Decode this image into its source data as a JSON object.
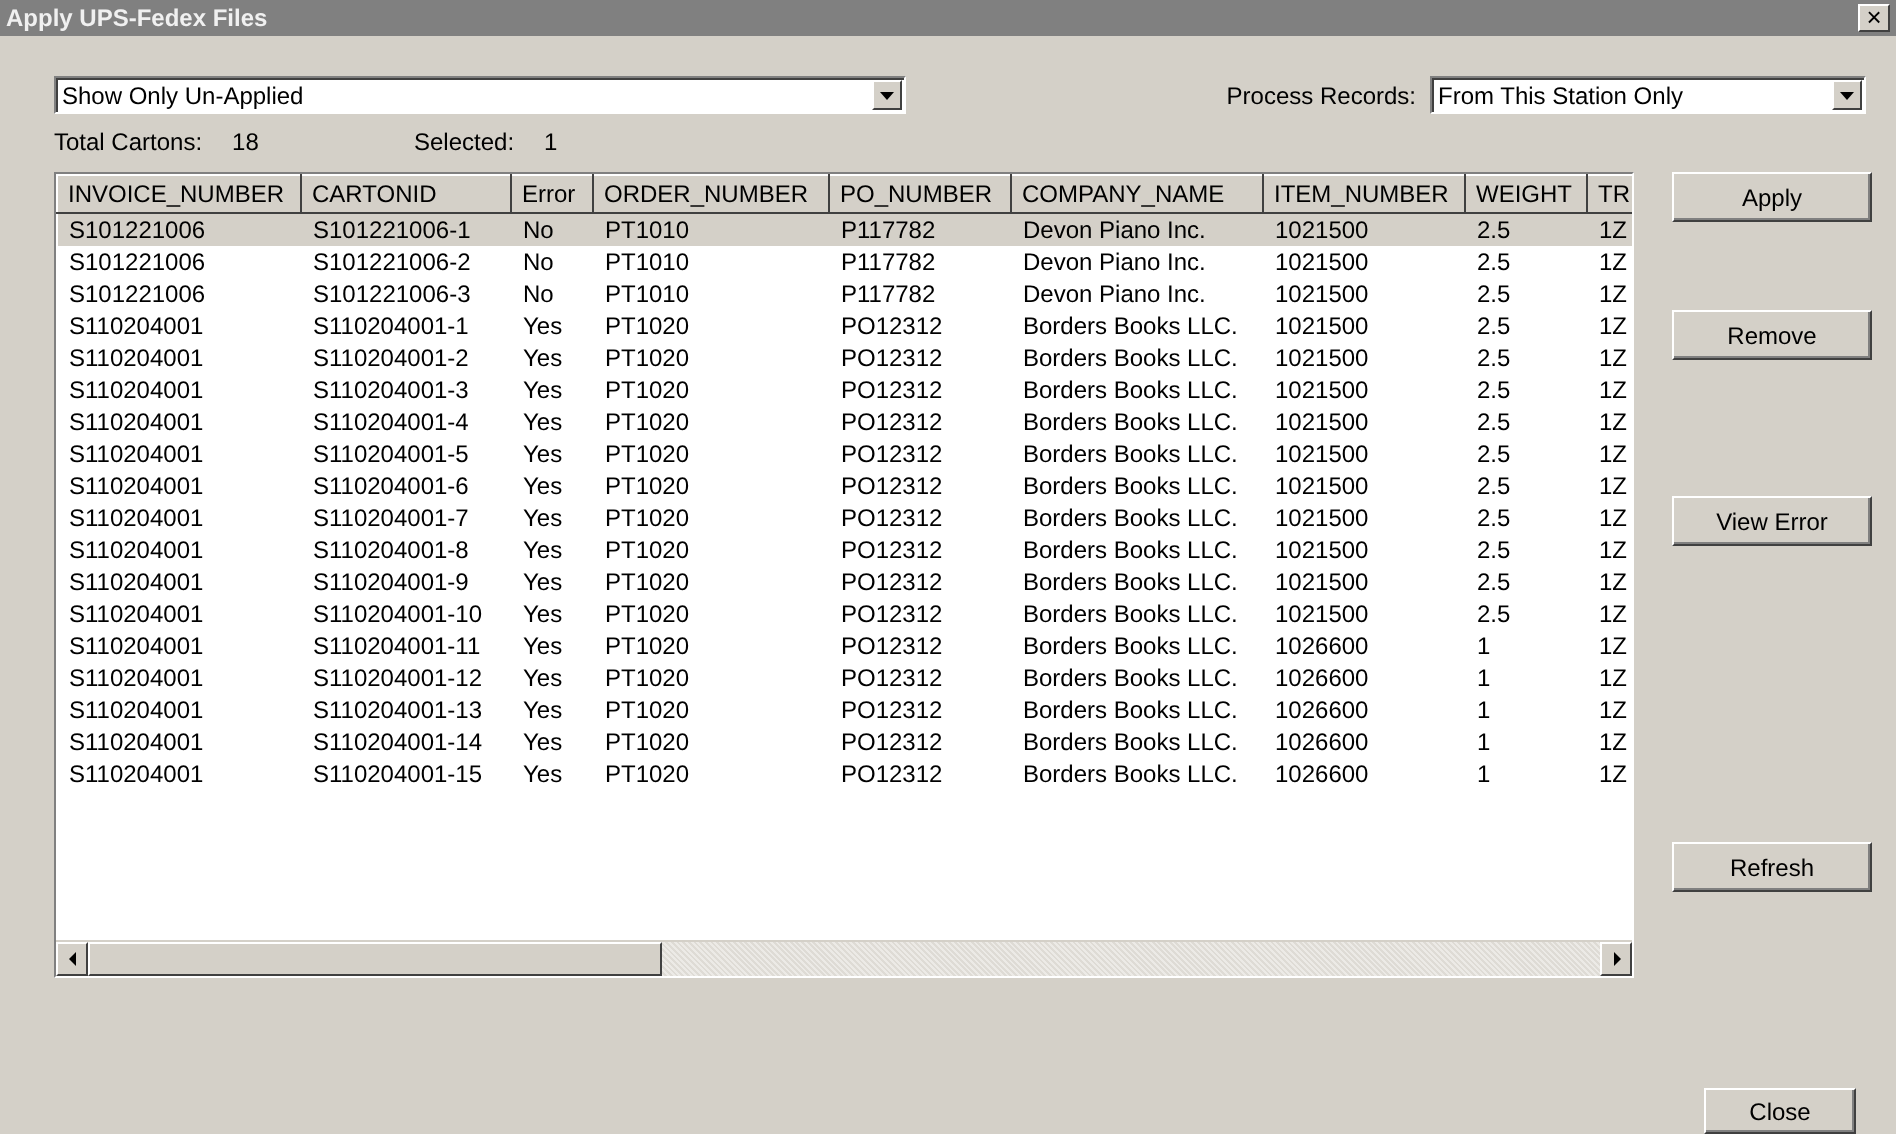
{
  "window": {
    "title": "Apply UPS-Fedex Files",
    "close": "×"
  },
  "filter": {
    "value": "Show Only Un-Applied"
  },
  "process_records": {
    "label": "Process Records:",
    "value": "From This Station Only"
  },
  "totals": [
    {
      "label": "Total Cartons:",
      "value": "18"
    },
    {
      "label": "Selected:",
      "value": "1"
    }
  ],
  "table": {
    "columns": [
      "INVOICE_NUMBER",
      "CARTONID",
      "Error",
      "ORDER_NUMBER",
      "PO_NUMBER",
      "COMPANY_NAME",
      "ITEM_NUMBER",
      "WEIGHT",
      "TR"
    ],
    "rows": [
      {
        "selected": true,
        "cells": [
          "S101221006",
          "S101221006-1",
          "No",
          "PT1010",
          "P117782",
          "Devon Piano Inc.",
          "1021500",
          "2.5",
          "1Z"
        ]
      },
      {
        "selected": false,
        "cells": [
          "S101221006",
          "S101221006-2",
          "No",
          "PT1010",
          "P117782",
          "Devon Piano Inc.",
          "1021500",
          "2.5",
          "1Z"
        ]
      },
      {
        "selected": false,
        "cells": [
          "S101221006",
          "S101221006-3",
          "No",
          "PT1010",
          "P117782",
          "Devon Piano Inc.",
          "1021500",
          "2.5",
          "1Z"
        ]
      },
      {
        "selected": false,
        "cells": [
          "S110204001",
          "S110204001-1",
          "Yes",
          "PT1020",
          "PO12312",
          "Borders Books LLC.",
          "1021500",
          "2.5",
          "1Z"
        ]
      },
      {
        "selected": false,
        "cells": [
          "S110204001",
          "S110204001-2",
          "Yes",
          "PT1020",
          "PO12312",
          "Borders Books LLC.",
          "1021500",
          "2.5",
          "1Z"
        ]
      },
      {
        "selected": false,
        "cells": [
          "S110204001",
          "S110204001-3",
          "Yes",
          "PT1020",
          "PO12312",
          "Borders Books LLC.",
          "1021500",
          "2.5",
          "1Z"
        ]
      },
      {
        "selected": false,
        "cells": [
          "S110204001",
          "S110204001-4",
          "Yes",
          "PT1020",
          "PO12312",
          "Borders Books LLC.",
          "1021500",
          "2.5",
          "1Z"
        ]
      },
      {
        "selected": false,
        "cells": [
          "S110204001",
          "S110204001-5",
          "Yes",
          "PT1020",
          "PO12312",
          "Borders Books LLC.",
          "1021500",
          "2.5",
          "1Z"
        ]
      },
      {
        "selected": false,
        "cells": [
          "S110204001",
          "S110204001-6",
          "Yes",
          "PT1020",
          "PO12312",
          "Borders Books LLC.",
          "1021500",
          "2.5",
          "1Z"
        ]
      },
      {
        "selected": false,
        "cells": [
          "S110204001",
          "S110204001-7",
          "Yes",
          "PT1020",
          "PO12312",
          "Borders Books LLC.",
          "1021500",
          "2.5",
          "1Z"
        ]
      },
      {
        "selected": false,
        "cells": [
          "S110204001",
          "S110204001-8",
          "Yes",
          "PT1020",
          "PO12312",
          "Borders Books LLC.",
          "1021500",
          "2.5",
          "1Z"
        ]
      },
      {
        "selected": false,
        "cells": [
          "S110204001",
          "S110204001-9",
          "Yes",
          "PT1020",
          "PO12312",
          "Borders Books LLC.",
          "1021500",
          "2.5",
          "1Z"
        ]
      },
      {
        "selected": false,
        "cells": [
          "S110204001",
          "S110204001-10",
          "Yes",
          "PT1020",
          "PO12312",
          "Borders Books LLC.",
          "1021500",
          "2.5",
          "1Z"
        ]
      },
      {
        "selected": false,
        "cells": [
          "S110204001",
          "S110204001-11",
          "Yes",
          "PT1020",
          "PO12312",
          "Borders Books LLC.",
          "1026600",
          "1",
          "1Z"
        ]
      },
      {
        "selected": false,
        "cells": [
          "S110204001",
          "S110204001-12",
          "Yes",
          "PT1020",
          "PO12312",
          "Borders Books LLC.",
          "1026600",
          "1",
          "1Z"
        ]
      },
      {
        "selected": false,
        "cells": [
          "S110204001",
          "S110204001-13",
          "Yes",
          "PT1020",
          "PO12312",
          "Borders Books LLC.",
          "1026600",
          "1",
          "1Z"
        ]
      },
      {
        "selected": false,
        "cells": [
          "S110204001",
          "S110204001-14",
          "Yes",
          "PT1020",
          "PO12312",
          "Borders Books LLC.",
          "1026600",
          "1",
          "1Z"
        ]
      },
      {
        "selected": false,
        "cells": [
          "S110204001",
          "S110204001-15",
          "Yes",
          "PT1020",
          "PO12312",
          "Borders Books LLC.",
          "1026600",
          "1",
          "1Z"
        ]
      }
    ]
  },
  "side_buttons": [
    "Apply",
    "Remove",
    "View Error",
    "Refresh"
  ],
  "close_button": "Close"
}
